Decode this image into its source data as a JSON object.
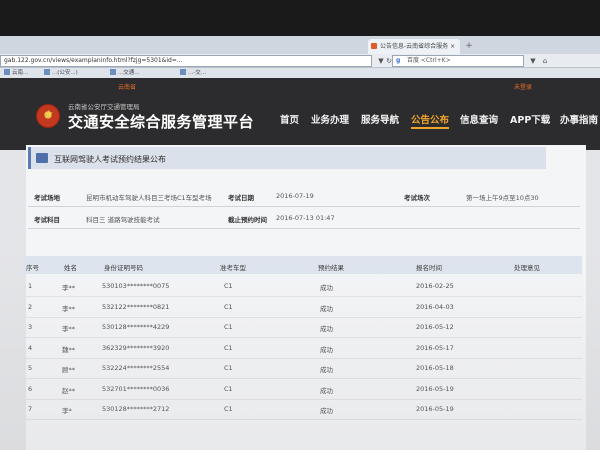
{
  "browser": {
    "tab_title": "公告信息-云南省综合服务 ×",
    "new_tab": "+",
    "url": "gab.122.gov.cn/views/examplaninfo.html?fzjg=5301&id=...",
    "search_label": "百度 <Ctrl+K>",
    "search_engine_glyph": "g",
    "nav_back": "◀",
    "nav_forward": "▶",
    "nav_reload": "↻",
    "nav_home": "⌂",
    "nav_down": "▼",
    "bookmarks": [
      "云南...",
      "...(公安...)",
      "...交通...",
      "...-交..."
    ]
  },
  "site_header": {
    "util_left": "云南省",
    "util_right": "未登录",
    "org_name": "云南省公安厅交通管理局",
    "site_title": "交通安全综合服务管理平台",
    "emblem_star": "★",
    "nav": [
      "首页",
      "业务办理",
      "服务导航",
      "公告公布",
      "信息查询",
      "APP下载",
      "办事指南"
    ],
    "active_nav": "公告公布"
  },
  "section": {
    "title": "互联网驾驶人考试预约结果公布"
  },
  "exam_info": {
    "date_label": "考试日期",
    "date_value": "2016-07-19",
    "venue_label": "考试场地",
    "venue_value": "昆明市机动车驾驶人科目三考场C1车型考场",
    "session_label": "考试场次",
    "session_value": "第一场上午9点至10点30",
    "subject_label": "考试科目",
    "subject_value": "科目三 道路驾驶技能考试",
    "deadline_label": "截止预约时间",
    "deadline_value": "2016-07-13 01:47"
  },
  "table": {
    "headers": [
      "序号",
      "姓名",
      "身份证明号码",
      "准考车型",
      "预约结果",
      "报名时间",
      "处理意见"
    ],
    "rows": [
      {
        "no": "1",
        "name": "李**",
        "id": "530103********0075",
        "type": "C1",
        "result": "成功",
        "date": "2016-02-25"
      },
      {
        "no": "2",
        "name": "李**",
        "id": "532122********0821",
        "type": "C1",
        "result": "成功",
        "date": "2016-04-03"
      },
      {
        "no": "3",
        "name": "李**",
        "id": "530128********4229",
        "type": "C1",
        "result": "成功",
        "date": "2016-05-12"
      },
      {
        "no": "4",
        "name": "魏**",
        "id": "362329********3920",
        "type": "C1",
        "result": "成功",
        "date": "2016-05-17"
      },
      {
        "no": "5",
        "name": "顾**",
        "id": "532224********2554",
        "type": "C1",
        "result": "成功",
        "date": "2016-05-18"
      },
      {
        "no": "6",
        "name": "赵**",
        "id": "532701********0036",
        "type": "C1",
        "result": "成功",
        "date": "2016-05-19"
      },
      {
        "no": "7",
        "name": "李*",
        "id": "530128********2712",
        "type": "C1",
        "result": "成功",
        "date": "2016-05-19"
      }
    ]
  },
  "colors": {
    "header_bg": "#2c2c2e",
    "active_nav": "#f0a32d",
    "section_accent": "#5a7bb4"
  }
}
